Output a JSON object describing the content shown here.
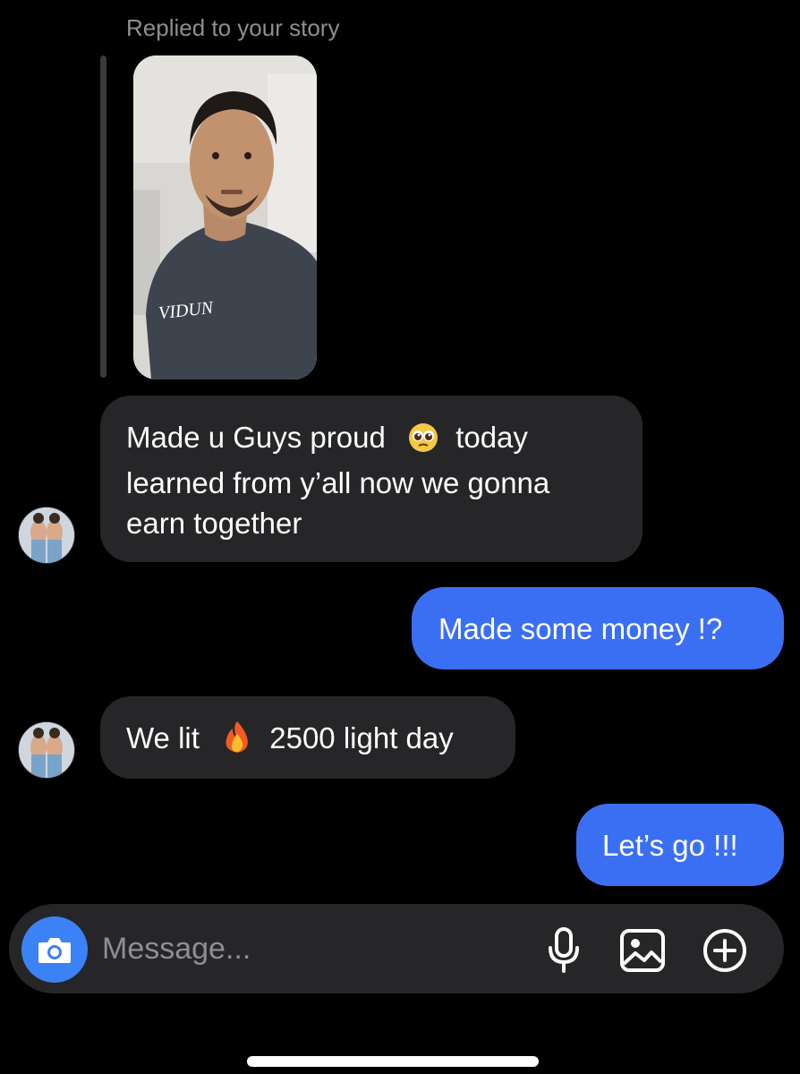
{
  "thread": {
    "reply_label": "Replied to your story",
    "story_shirt_text": "VIDUN"
  },
  "messages": [
    {
      "direction": "incoming",
      "lines": [
        "Made u Guys proud",
        "today",
        "learned from y’all now we gonna",
        "earn together"
      ],
      "emoji": "pleading-face-emoji"
    },
    {
      "direction": "outgoing",
      "text": "Made some money !?"
    },
    {
      "direction": "incoming",
      "text_before_emoji": "We lit",
      "text_after_emoji": "2500 light day",
      "emoji": "fire-emoji"
    },
    {
      "direction": "outgoing",
      "text": "Let’s go !!!"
    }
  ],
  "composer": {
    "placeholder": "Message...",
    "icons": [
      "camera-icon",
      "microphone-icon",
      "gallery-icon",
      "plus-circle-icon"
    ]
  },
  "colors": {
    "background": "#000000",
    "incoming_bubble": "#262628",
    "outgoing_bubble": "#3b6ff3",
    "camera_button": "#3b82f6",
    "muted_text": "#8e8e93"
  }
}
